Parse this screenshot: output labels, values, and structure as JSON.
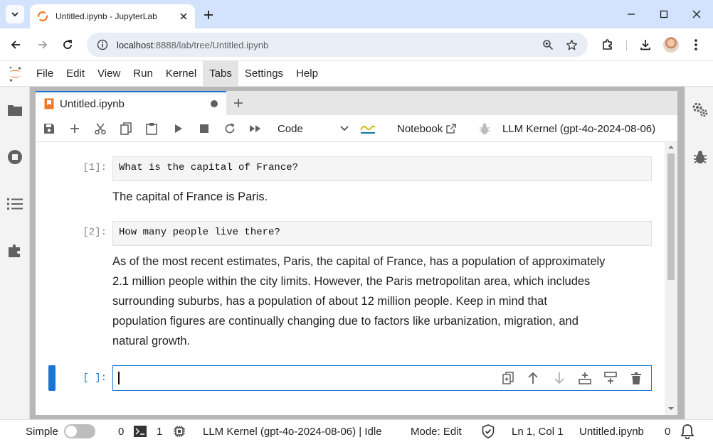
{
  "browser": {
    "tab_title": "Untitled.ipynb - JupyterLab",
    "url_host": "localhost",
    "url_path": ":8888/lab/tree/Untitled.ipynb"
  },
  "menubar": {
    "items": [
      "File",
      "Edit",
      "View",
      "Run",
      "Kernel",
      "Tabs",
      "Settings",
      "Help"
    ],
    "active": "Tabs"
  },
  "notebook": {
    "tab_label": "Untitled.ipynb",
    "toolbar": {
      "cell_type": "Code",
      "notebook_label": "Notebook",
      "kernel_label": "LLM Kernel (gpt-4o-2024-08-06)"
    },
    "cells": [
      {
        "prompt": "[1]:",
        "input": "What is the capital of France?",
        "output_lines": [
          "The capital of France is Paris."
        ]
      },
      {
        "prompt": "[2]:",
        "input": "How many people live there?",
        "output_lines": [
          "As of the most recent estimates, Paris, the capital of France, has a population of approximately",
          "2.1 million people within the city limits. However, the Paris metropolitan area, which includes",
          "surrounding suburbs, has a population of about 12 million people. Keep in mind that",
          "population figures are continually changing due to factors like urbanization, migration, and",
          "natural growth."
        ]
      },
      {
        "prompt": "[ ]:",
        "input": "",
        "active": true
      }
    ]
  },
  "statusbar": {
    "mode_label": "Simple",
    "terminals_count": "0",
    "kernels_count": "1",
    "kernel_status": "LLM Kernel (gpt-4o-2024-08-06) | Idle",
    "edit_mode": "Mode: Edit",
    "cursor_pos": "Ln 1, Col 1",
    "file_name": "Untitled.ipynb",
    "notifications": "0"
  },
  "colors": {
    "accent": "#1976d2",
    "jupyter_orange": "#f37726",
    "browser_frame": "#d3e3fd"
  }
}
